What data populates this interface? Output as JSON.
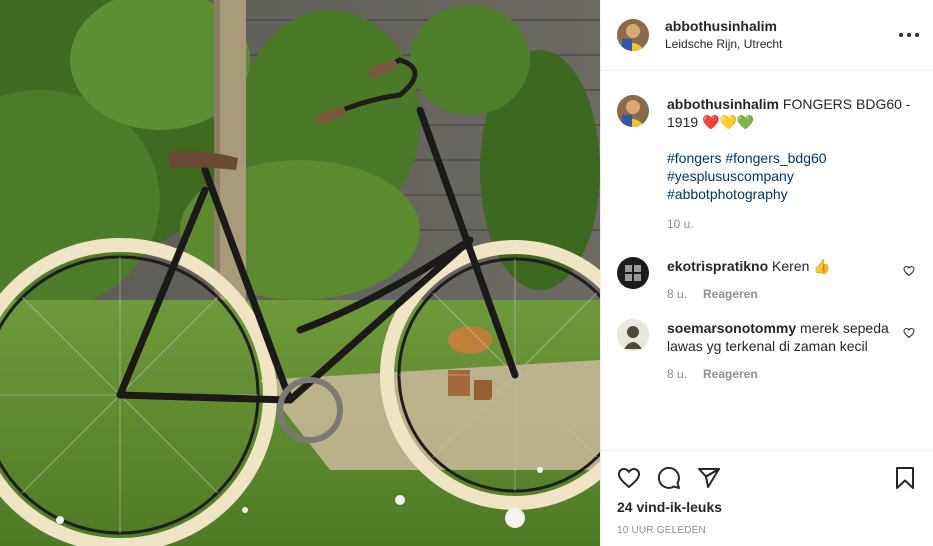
{
  "post": {
    "author": {
      "username": "abbothusinhalim",
      "location": "Leidsche Rijn, Utrecht"
    },
    "caption": {
      "username": "abbothusinhalim",
      "text": "FONGERS BDG60 - 1919 ❤️💛💚",
      "hashtags": [
        "#fongers #fongers_bdg60",
        "#yesplususcompany",
        "#abbotphotography"
      ],
      "age": "10 u."
    },
    "comments": [
      {
        "username": "ekotrispratikno",
        "text": "Keren 👍",
        "age": "8 u.",
        "reply_label": "Reageren"
      },
      {
        "username": "soemarsonotommy",
        "text": "merek sepeda lawas yg terkenal di zaman kecil",
        "age": "8 u.",
        "reply_label": "Reageren"
      }
    ],
    "likes": "24 vind-ik-leuks",
    "timestamp": "10 UUR GELEDEN"
  },
  "icons": {
    "more": "more-options-icon",
    "like": "heart-icon",
    "comment": "comment-icon",
    "share": "share-icon",
    "save": "bookmark-icon",
    "comment_like": "heart-icon"
  },
  "colors": {
    "text": "#262626",
    "secondary": "#8e8e8e",
    "hashtag": "#00376b",
    "border": "#efefef"
  }
}
